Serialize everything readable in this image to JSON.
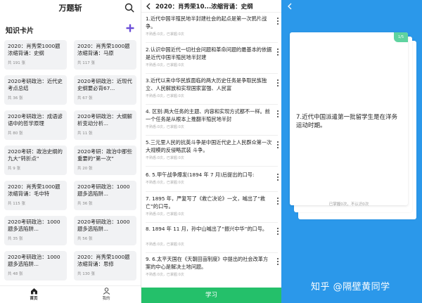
{
  "screen1": {
    "app_title": "万题斩",
    "section_title": "知识卡片",
    "cards": [
      {
        "title": "2020：肖秀荣1000题浓缩背诵：史纲",
        "count": "共 191 张"
      },
      {
        "title": "2020：肖秀荣1000题浓缩背诵：马原",
        "count": "共 117 张"
      },
      {
        "title": "2020考研政治：近代史考点总结",
        "count": "共 36 张"
      },
      {
        "title": "2020考研政治：近现代史纲要必背67...",
        "count": "共 67 张"
      },
      {
        "title": "2020考研政治：成语谚语中的哲学原理",
        "count": "共 80 张"
      },
      {
        "title": "2020考研政治：大纲解析变动分析...",
        "count": "共 11 张"
      },
      {
        "title": "2020考研：政治史纲的九大“转折点”",
        "count": "共 9 张"
      },
      {
        "title": "2020考研：政治中那些重要的“第一次”",
        "count": "共 20 张"
      },
      {
        "title": "2020：肖秀荣1000题浓缩背诵：毛中特",
        "count": "共 115 张"
      },
      {
        "title": "2020考研政治：1000题多选陷阱...",
        "count": "共 36 张"
      },
      {
        "title": "2020考研政治：1000题多选陷阱...",
        "count": "共 35 张"
      },
      {
        "title": "2020考研政治：1000题多选陷阱...",
        "count": "共 56 张"
      },
      {
        "title": "2020考研政治：1000题多选陷阱...",
        "count": "共 48 张"
      },
      {
        "title": "2020：肖秀荣1000题浓缩背诵：思修",
        "count": "共 130 张"
      }
    ],
    "tabs": [
      {
        "label": "首页"
      },
      {
        "label": "我的"
      }
    ]
  },
  "screen2": {
    "title": "2020：肖秀荣10...浓缩背诵：史纲",
    "questions": [
      {
        "text": "1.近代中国半殖民地半封建社会的起点是第一次鸦片战争。",
        "meta": "不熟悉:0次，已掌握:0次"
      },
      {
        "text": "2.认识中国近代一切社会问题和革命问题的最基本的依据是近代中国半殖民地半封建",
        "meta": "不熟悉:0次，已掌握:0次"
      },
      {
        "text": "3.近代以来中华民族面临的两大历史任务是争取民族独立、人民解放和实现国家富强、人民富",
        "meta": "不熟悉:0次，已掌握:0次"
      },
      {
        "text": "4. 区别:两大任务的主题、内容和实现方式都不一样。前一个任务是从根本上推翻半殖民地半封",
        "meta": "不熟悉:0次，已掌握:0次"
      },
      {
        "text": "5.三元里人民的抗英斗争是中国近代史上人民群众第一次大规模的反侵略武装 斗争。",
        "meta": "不熟悉:0次，已掌握:0次"
      },
      {
        "text": "6. 5.甲午战争爆发(1894 年 7 月)后提出的口号:",
        "meta": "不熟悉:0次，已掌握:0次"
      },
      {
        "text": "7. 1895 年，严复写了《救亡决论》一文，喊出了“救亡”的口号。",
        "meta": "不熟悉:0次，已掌握:0次"
      },
      {
        "text": "8. 1894 年 11 月，孙中山喊出了“振兴中华”的口号。",
        "meta": "不熟悉:0次，已掌握:0次"
      },
      {
        "text": "9. 6.太平天国在《天朝田亩制度》中提出的社会改革方案的中心是解决土地问题。",
        "meta": "不熟悉:0次，已掌握:0次"
      }
    ],
    "study_button": "学习"
  },
  "screen3": {
    "badge": "1/5",
    "question": "7.近代中国派遣第一批留学生是在洋务运动时期。",
    "meta": "已掌握0次，不认识0次",
    "watermark": "知乎 @隔壁黄同学"
  },
  "colors": {
    "accent_purple": "#6c4fd8",
    "study_green": "#24c06a",
    "flash_blue": "#2b98ea",
    "badge_green": "#5fd3a0"
  }
}
